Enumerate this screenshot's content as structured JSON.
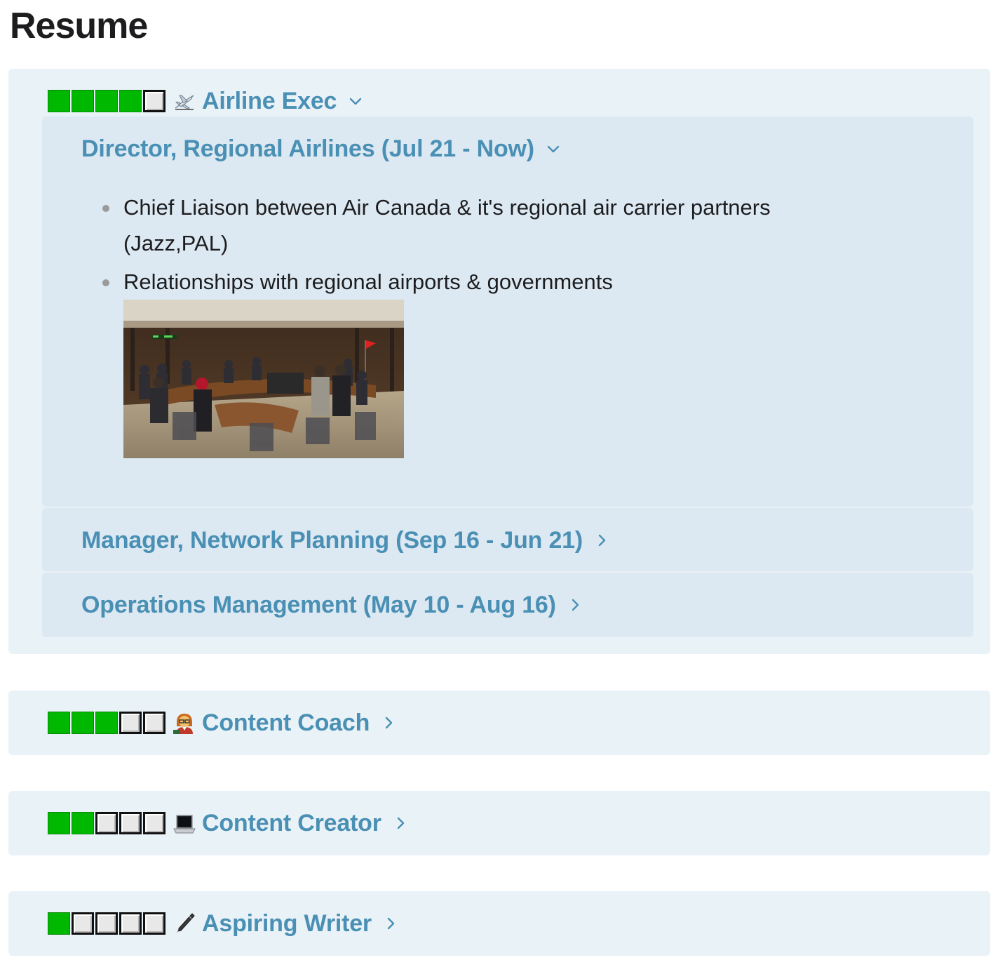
{
  "page": {
    "title": "Resume"
  },
  "colors": {
    "accent": "#4a8fb4",
    "group_bg": "#e9f2f7",
    "job_bg": "#dce9f2",
    "rating_on": "#00b800",
    "rating_off": "#e8e8e8"
  },
  "groups": [
    {
      "title": "Airline Exec",
      "icon": "airplane-icon",
      "rating": 4,
      "rating_max": 5,
      "expanded": true,
      "jobs": [
        {
          "title": "Director, Regional Airlines (Jul 21 - Now)",
          "expanded": true,
          "bullets": [
            "Chief Liaison between Air Canada & it's regional air carrier partners (Jazz,PAL)",
            "Relationships with regional airports & governments"
          ],
          "image": "committee-meeting-photo"
        },
        {
          "title": "Manager, Network Planning (Sep 16 - Jun 21)",
          "expanded": false
        },
        {
          "title": "Operations Management (May 10 - Aug 16)",
          "expanded": false
        }
      ]
    },
    {
      "title": "Content Coach",
      "icon": "teacher-icon",
      "rating": 3,
      "rating_max": 5,
      "expanded": false
    },
    {
      "title": "Content Creator",
      "icon": "laptop-icon",
      "rating": 2,
      "rating_max": 5,
      "expanded": false
    },
    {
      "title": "Aspiring Writer",
      "icon": "pen-icon",
      "rating": 1,
      "rating_max": 5,
      "expanded": false
    }
  ]
}
